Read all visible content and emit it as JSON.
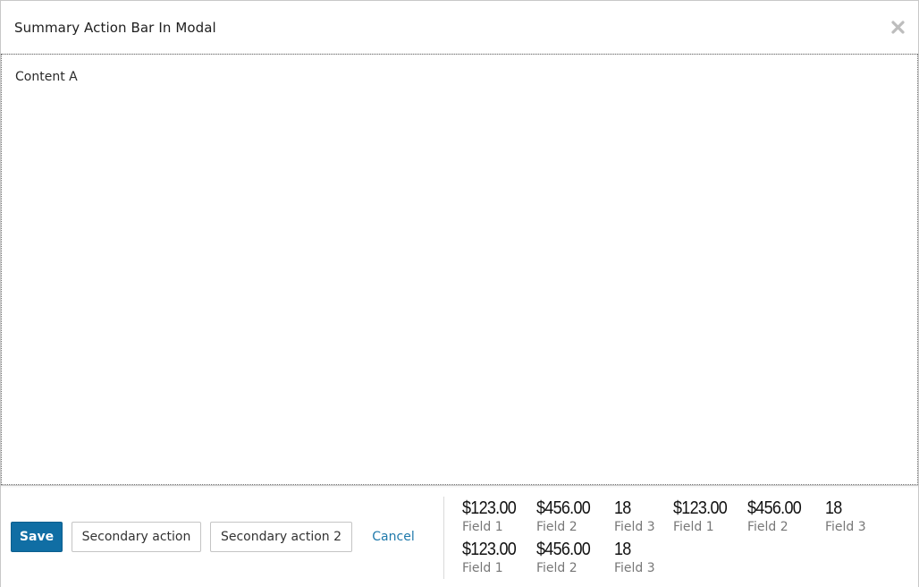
{
  "modal": {
    "title": "Summary Action Bar In Modal",
    "close_icon": "close-icon",
    "content_text": "Content A"
  },
  "actions": {
    "save_label": "Save",
    "secondary_label": "Secondary action",
    "secondary2_label": "Secondary action 2",
    "cancel_label": "Cancel"
  },
  "summary": {
    "items": [
      {
        "value": "$123.00",
        "label": "Field 1"
      },
      {
        "value": "$456.00",
        "label": "Field 2"
      },
      {
        "value": "18",
        "label": "Field 3"
      },
      {
        "value": "$123.00",
        "label": "Field 1"
      },
      {
        "value": "$456.00",
        "label": "Field 2"
      },
      {
        "value": "18",
        "label": "Field 3"
      },
      {
        "value": "$123.00",
        "label": "Field 1"
      },
      {
        "value": "$456.00",
        "label": "Field 2"
      },
      {
        "value": "18",
        "label": "Field 3"
      }
    ]
  },
  "colors": {
    "primary": "#106ea4",
    "link": "#1f79ab",
    "label_gray": "#777777"
  }
}
